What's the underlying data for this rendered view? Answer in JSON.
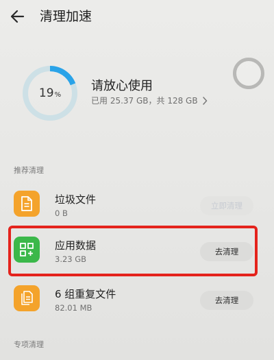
{
  "header": {
    "title": "清理加速"
  },
  "storage": {
    "percent": "19",
    "percent_unit": "%",
    "percent_value": 19,
    "status": "请放心使用",
    "usage": "已用 25.37 GB，共 128 GB"
  },
  "sections": {
    "recommended": "推荐清理",
    "special": "专项清理"
  },
  "items": [
    {
      "name": "垃圾文件",
      "size": "0 B",
      "button": "立即清理",
      "icon": "document-icon",
      "color": "#f4a32b"
    },
    {
      "name": "应用数据",
      "size": "3.23 GB",
      "button": "去清理",
      "icon": "app-grid-icon",
      "color": "#3bb84a"
    },
    {
      "name": "6 组重复文件",
      "size": "82.01 MB",
      "button": "去清理",
      "icon": "duplicate-file-icon",
      "color": "#f4a32b"
    }
  ],
  "colors": {
    "ring_progress": "#2aa3e8",
    "ring_track": "#cde0e6",
    "highlight": "#e4231c"
  }
}
